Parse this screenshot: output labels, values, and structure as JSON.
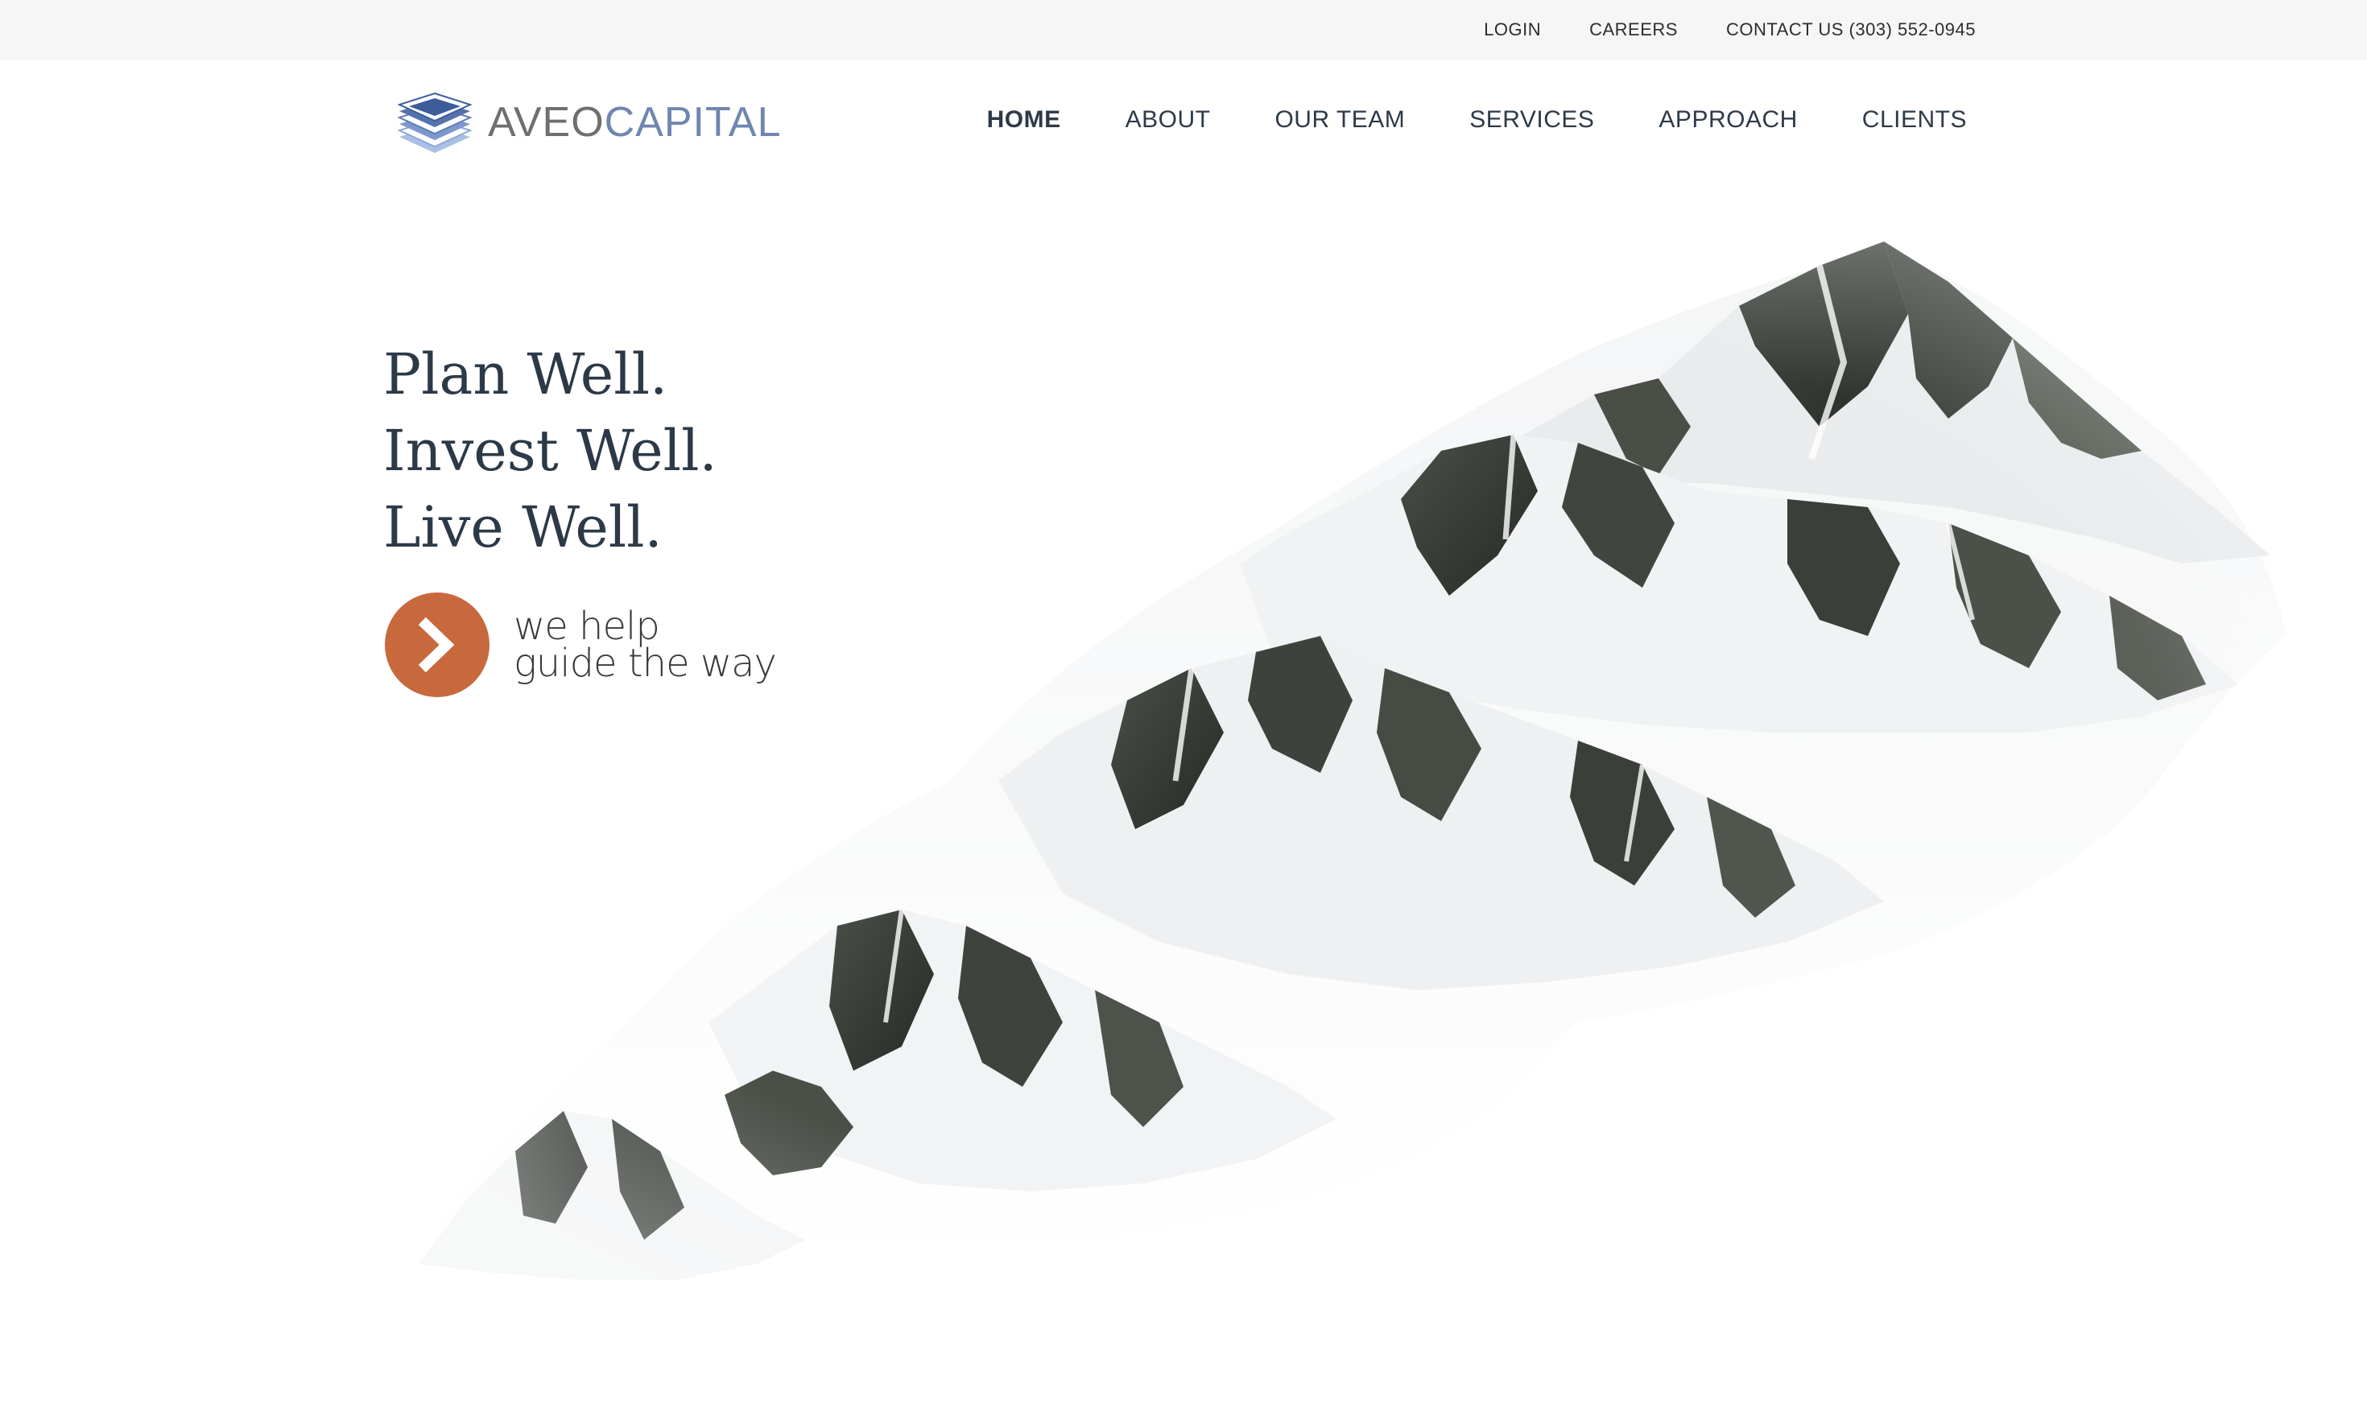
{
  "topbar": {
    "links": [
      {
        "label": "LOGIN"
      },
      {
        "label": "CAREERS"
      },
      {
        "label": "CONTACT US (303) 552-0945"
      }
    ]
  },
  "header": {
    "logo": {
      "part1": "AVEO",
      "part2": "CAPITAL",
      "icon": "layered-diamond-logo"
    },
    "nav": [
      {
        "label": "HOME",
        "active": true
      },
      {
        "label": "ABOUT"
      },
      {
        "label": "OUR TEAM"
      },
      {
        "label": "SERVICES"
      },
      {
        "label": "APPROACH"
      },
      {
        "label": "CLIENTS"
      }
    ]
  },
  "hero": {
    "tagline": [
      "Plan Well.",
      "Invest Well.",
      "Live Well."
    ],
    "cta": {
      "line1": "we help",
      "line2": "guide the way",
      "icon": "chevron-right-icon"
    },
    "image": "snowy-mountain-range"
  },
  "colors": {
    "topbar_bg": "#f6f6f6",
    "nav_text": "#2e3a48",
    "logo_gray": "#6f6f72",
    "logo_blue": "#6f86b0",
    "accent_orange": "#c8693d"
  }
}
